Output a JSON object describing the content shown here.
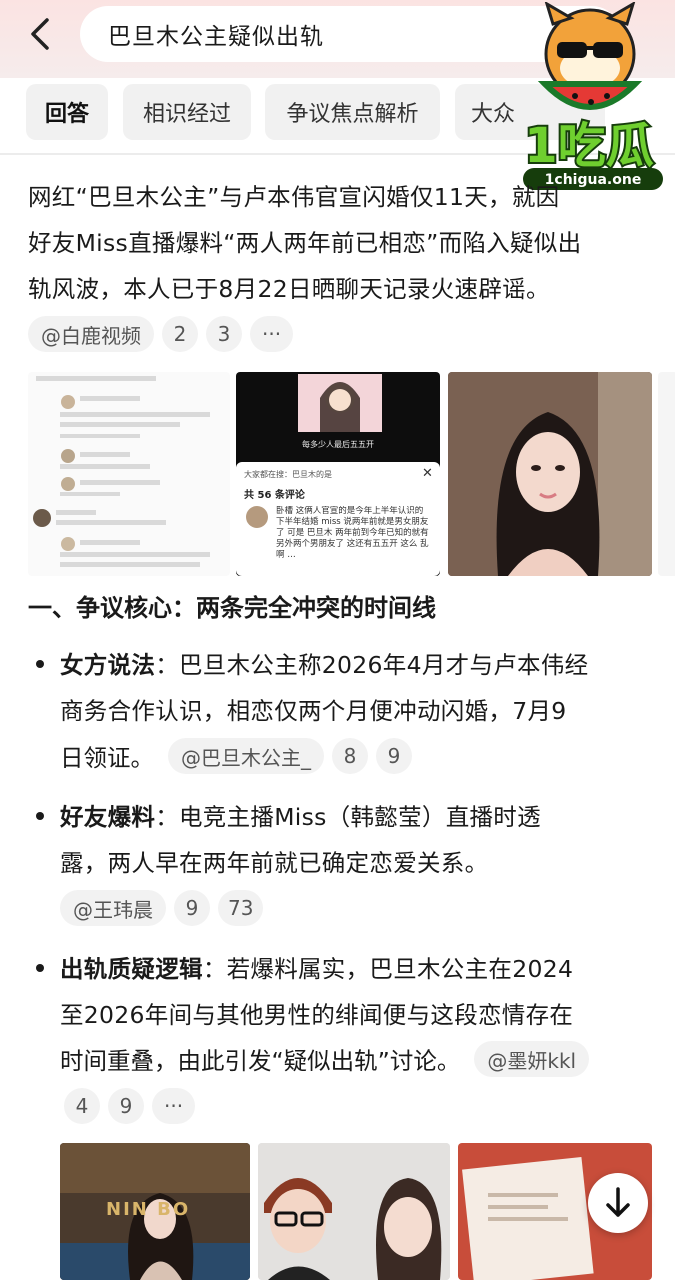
{
  "search": {
    "query": "巴旦木公主疑似出轨"
  },
  "tabs": [
    "回答",
    "相识经过",
    "争议焦点解析",
    "大众"
  ],
  "watermark": {
    "logo_text": "1吃瓜",
    "site": "1chigua.one"
  },
  "intro": {
    "lines": [
      "网红“巴旦木公主”与卢本伟官宣闪婚仅11天，就因",
      "好友Miss直播爆料“两人两年前已相恋”而陷入疑似出",
      "轨风波，本人已于8月22日晒聊天记录火速辟谣。"
    ],
    "source": "@白鹿视频",
    "counts": [
      "2",
      "3"
    ],
    "more": "···"
  },
  "image_strip_1": {
    "comment_header": "共 56 条评论",
    "overlay_title": "大家都在搜：巴旦木的是",
    "comment_text": "卧槽 这俩人官宣的是今年上半年认识的 下半年结婚 miss 说两年前就是男女朋友了 可是 巴旦木 两年前到今年已知的就有另外两个男朋友了 这还有五五开 这么 乱啊 …",
    "video_caption": "每多少人最后五五开"
  },
  "section1": {
    "heading": "一、争议核心：两条完全冲突的时间线",
    "items": [
      {
        "label": "女方说法",
        "lines": [
          "：巴旦木公主称2026年4月才与卢本伟经",
          "商务合作认识，相恋仅两个月便冲动闪婚，7月9",
          "日领证。"
        ],
        "source": "@巴旦木公主_",
        "counts": [
          "8",
          "9"
        ]
      },
      {
        "label": "好友爆料",
        "lines": [
          "：电竞主播Miss（韩懿莹）直播时透",
          "露，两人早在两年前就已确定恋爱关系。"
        ],
        "source": "@王玮晨",
        "counts": [
          "9",
          "73"
        ]
      },
      {
        "label": "出轨质疑逻辑",
        "lines": [
          "：若爆料属实，巴旦木公主在2024",
          "至2026年间与其他男性的绯闻便与这段恋情存在",
          "时间重叠，由此引发“疑似出轨”讨论。"
        ],
        "source": "@墨妍kkl",
        "counts": [
          "4",
          "9"
        ],
        "more": "···"
      }
    ]
  },
  "image_strip_2": {
    "sign_text": "NIN BO"
  },
  "colors": {
    "accent_green": "#6fcf2f",
    "header_pink": "#fbe3e2",
    "chip_bg": "#f2f2f2"
  }
}
